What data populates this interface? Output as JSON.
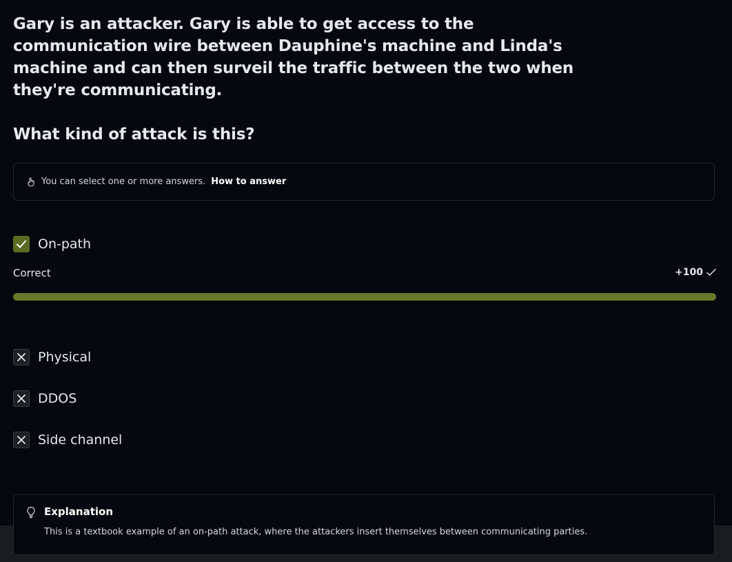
{
  "question": {
    "text": "Gary is an attacker. Gary is able to get access to the communication wire between Dauphine's machine and Linda's machine and can then surveil the traffic between the two when they're communicating.",
    "prompt": "What kind of attack is this?"
  },
  "hint": {
    "text": "You can select one or more answers.",
    "link": "How to answer",
    "icon": "hand-pointer-icon"
  },
  "options": [
    {
      "label": "On-path",
      "state": "selected-correct",
      "icon": "check-icon"
    },
    {
      "label": "Physical",
      "state": "incorrect",
      "icon": "x-icon"
    },
    {
      "label": "DDOS",
      "state": "incorrect",
      "icon": "x-icon"
    },
    {
      "label": "Side channel",
      "state": "incorrect",
      "icon": "x-icon"
    }
  ],
  "result": {
    "label": "Correct",
    "score": "+100",
    "progress_fraction": 1.0
  },
  "explanation": {
    "title": "Explanation",
    "text": "This is a textbook example of an on-path attack, where the attackers insert themselves between communicating parties.",
    "icon": "lightbulb-icon"
  },
  "colors": {
    "background": "#05080e",
    "accent_green": "#68782a",
    "checked_box": "#5b6b24"
  }
}
